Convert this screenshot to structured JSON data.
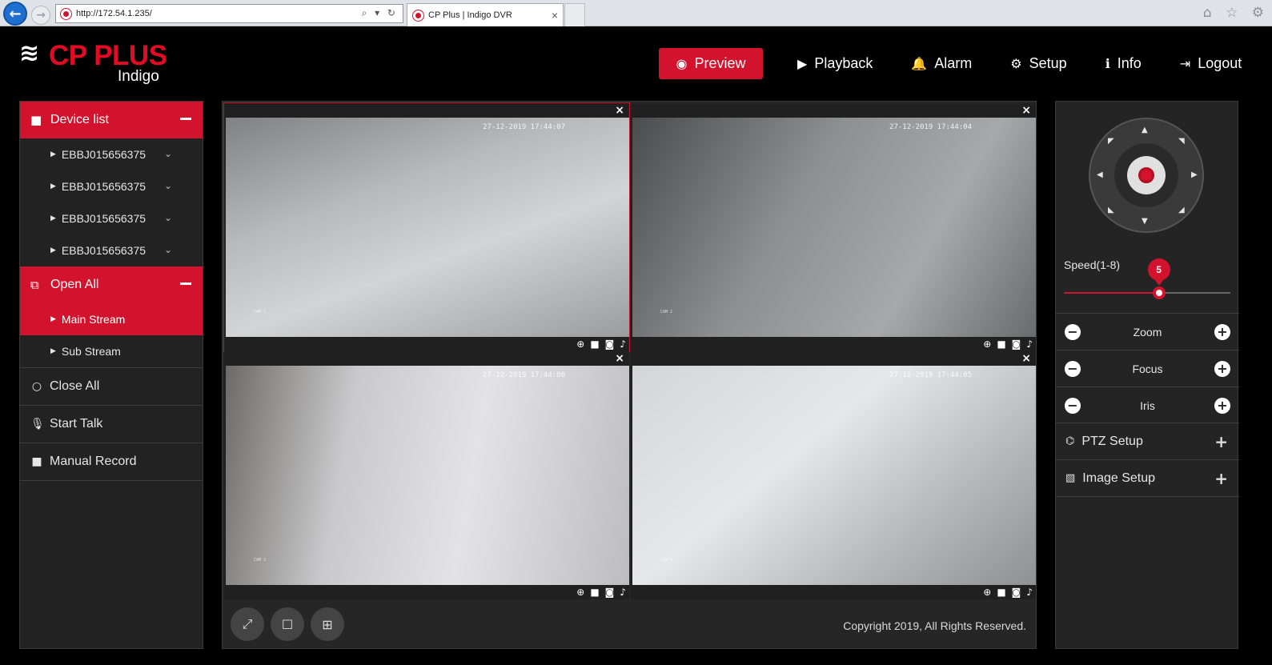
{
  "browser": {
    "url": "http://172.54.1.235/",
    "tab_title": "CP Plus | Indigo DVR",
    "address_tools": "⌕ ▾ ↻",
    "tab_close": "×",
    "right_icons": "⌂ ☆ ⚙"
  },
  "brand": {
    "name": "CP PLUS",
    "subtitle": "Indigo",
    "accent": "#d3122d"
  },
  "nav": {
    "items": [
      {
        "label": "Preview",
        "icon": "eye-icon",
        "glyph": "◉",
        "active": true
      },
      {
        "label": "Playback",
        "icon": "play-icon",
        "glyph": "▶",
        "active": false
      },
      {
        "label": "Alarm",
        "icon": "bell-icon",
        "glyph": "🔔",
        "active": false
      },
      {
        "label": "Setup",
        "icon": "gear-icon",
        "glyph": "⚙",
        "active": false
      },
      {
        "label": "Info",
        "icon": "info-icon",
        "glyph": "ℹ",
        "active": false
      },
      {
        "label": "Logout",
        "icon": "logout-icon",
        "glyph": "⇥",
        "active": false
      }
    ]
  },
  "sidebar": {
    "device_list": {
      "label": "Device list",
      "icon": "camera-icon",
      "glyph": "■"
    },
    "devices": [
      "EBBJ015656375",
      "EBBJ015656375",
      "EBBJ015656375",
      "EBBJ015656375"
    ],
    "open_all": {
      "label": "Open All",
      "icon": "external-link-icon",
      "glyph": "⧉"
    },
    "streams": [
      {
        "label": "Main Stream",
        "active": true
      },
      {
        "label": "Sub Stream",
        "active": false
      }
    ],
    "actions": [
      {
        "label": "Close All",
        "icon": "circle-icon",
        "glyph": "○"
      },
      {
        "label": "Start Talk",
        "icon": "microphone-icon",
        "glyph": "🎙"
      },
      {
        "label": "Manual Record",
        "icon": "video-camera-icon",
        "glyph": "■"
      }
    ]
  },
  "cameras": [
    {
      "timestamp": "27-12-2019 17:44:07",
      "label": "CAM 1",
      "selected": true
    },
    {
      "timestamp": "27-12-2019 17:44:04",
      "label": "CAM 2",
      "selected": false
    },
    {
      "timestamp": "27-12-2019 17:44:06",
      "label": "CAM 3",
      "selected": false
    },
    {
      "timestamp": "27-12-2019 17:44:05",
      "label": "CAM 4",
      "selected": false
    }
  ],
  "grid_controls": {
    "fullscreen": "⤢",
    "single": "☐",
    "quad": "⊞"
  },
  "footer": {
    "copyright": "Copyright 2019, All Rights Reserved."
  },
  "ptz": {
    "speed_label": "Speed(1-8)",
    "speed_value": "5",
    "speed_fraction": 0.57,
    "controls": [
      {
        "label": "Zoom"
      },
      {
        "label": "Focus"
      },
      {
        "label": "Iris"
      }
    ],
    "setup": [
      {
        "label": "PTZ Setup",
        "icon": "gamepad-icon",
        "glyph": "⌬"
      },
      {
        "label": "Image Setup",
        "icon": "image-icon",
        "glyph": "▧"
      }
    ]
  }
}
